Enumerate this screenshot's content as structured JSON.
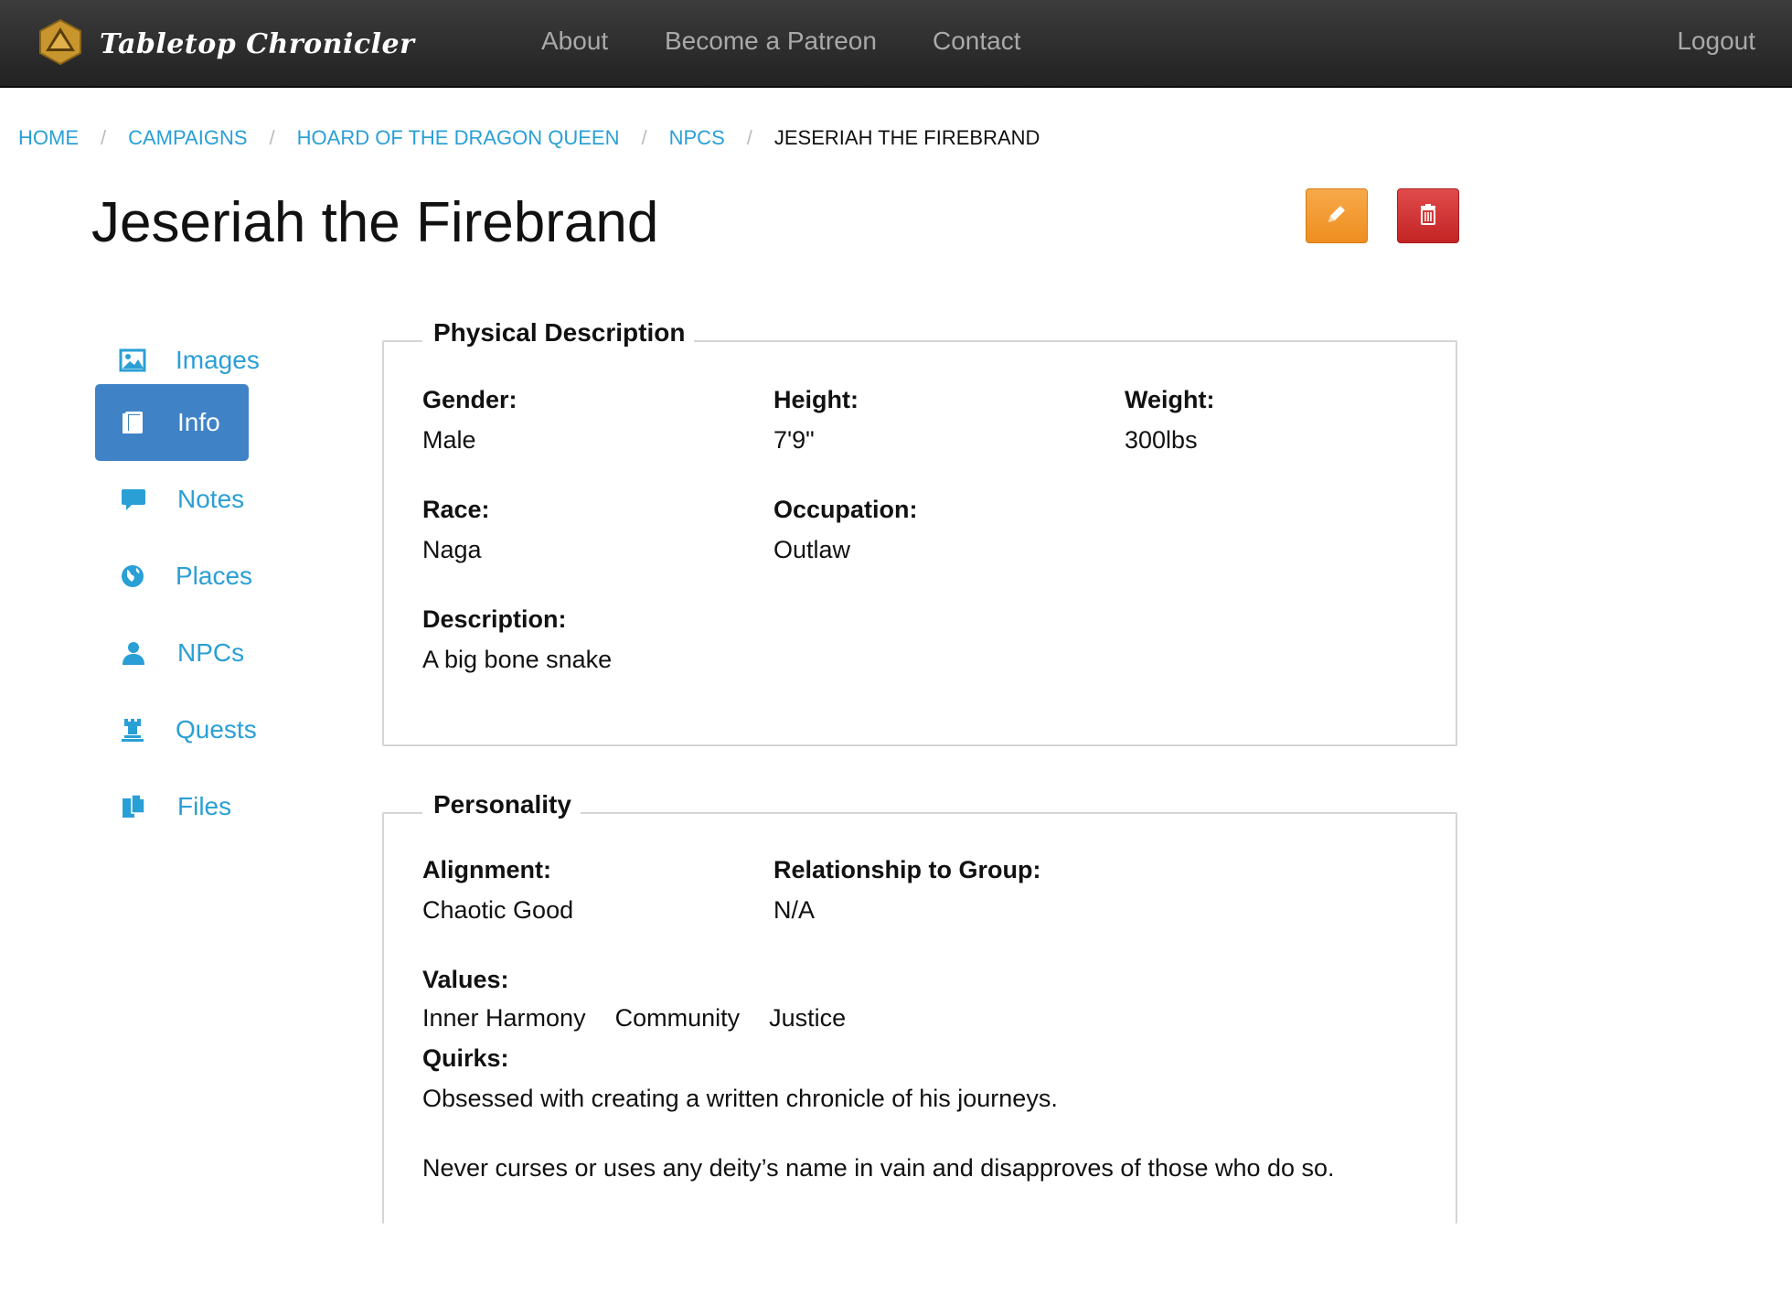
{
  "app": {
    "brand_name": "Tabletop Chronicler",
    "nav": {
      "about": "About",
      "patreon": "Become a Patreon",
      "contact": "Contact",
      "logout": "Logout"
    }
  },
  "breadcrumb": {
    "home": "HOME",
    "campaigns": "CAMPAIGNS",
    "campaign": "HOARD OF THE DRAGON QUEEN",
    "npcs": "NPCS",
    "current": "JESERIAH THE FIREBRAND",
    "separator": "/"
  },
  "page": {
    "title": "Jeseriah the Firebrand",
    "edit_icon": "pencil-icon",
    "delete_icon": "trash-icon"
  },
  "sidebar": {
    "items": [
      {
        "label": "Images",
        "icon": "image-icon"
      },
      {
        "label": "Info",
        "icon": "book-icon",
        "active": true
      },
      {
        "label": "Notes",
        "icon": "comment-icon"
      },
      {
        "label": "Places",
        "icon": "globe-icon"
      },
      {
        "label": "NPCs",
        "icon": "user-icon"
      },
      {
        "label": "Quests",
        "icon": "rook-icon"
      },
      {
        "label": "Files",
        "icon": "files-icon"
      }
    ]
  },
  "physical": {
    "legend": "Physical Description",
    "gender_label": "Gender:",
    "gender": "Male",
    "height_label": "Height:",
    "height": "7'9\"",
    "weight_label": "Weight:",
    "weight": "300lbs",
    "race_label": "Race:",
    "race": "Naga",
    "occupation_label": "Occupation:",
    "occupation": "Outlaw",
    "description_label": "Description:",
    "description": "A big bone snake"
  },
  "personality": {
    "legend": "Personality",
    "alignment_label": "Alignment:",
    "alignment": "Chaotic Good",
    "relationship_label": "Relationship to Group:",
    "relationship": "N/A",
    "values_label": "Values:",
    "values": [
      "Inner Harmony",
      "Community",
      "Justice"
    ],
    "quirks_label": "Quirks:",
    "quirks": [
      "Obsessed with creating a written chronicle of his journeys.",
      "Never curses or uses any deity’s name in vain and disapproves of those who do so."
    ]
  },
  "colors": {
    "link": "#2a9fd6",
    "active_nav": "#3f83c6",
    "edit_button": "#ee8e1f",
    "delete_button": "#c32424",
    "navbar": "#2b2b2b"
  }
}
